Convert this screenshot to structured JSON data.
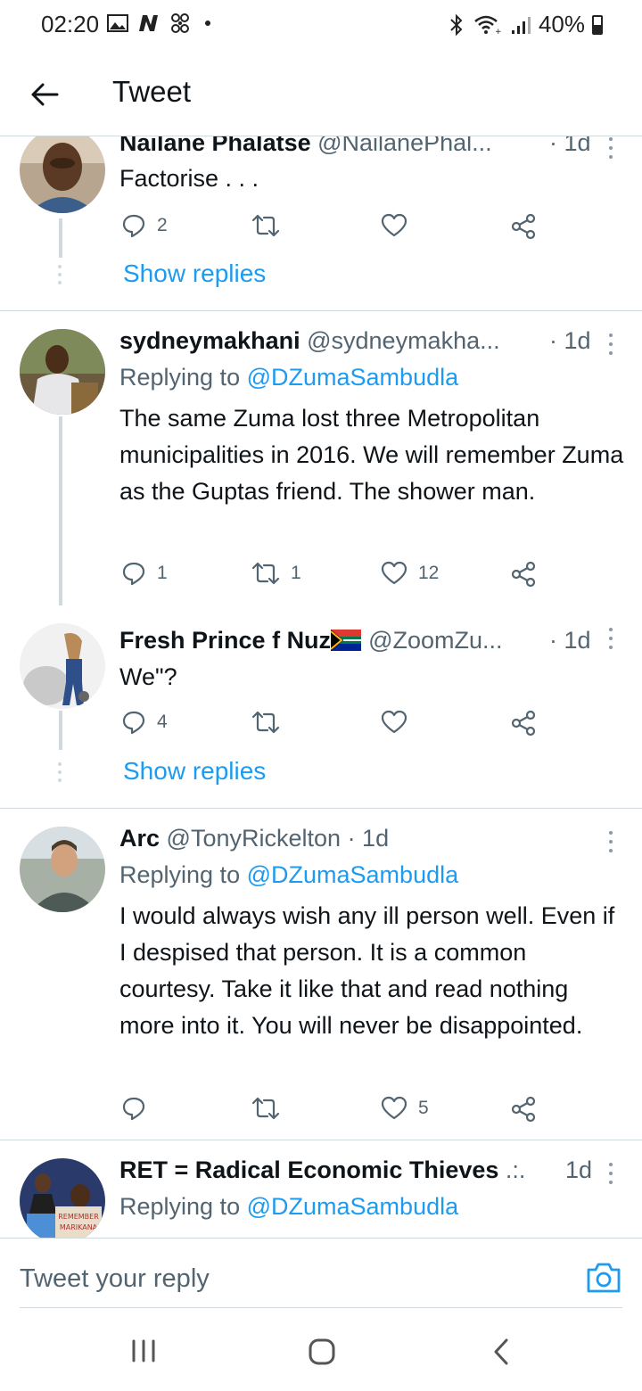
{
  "status_bar": {
    "time": "02:20",
    "battery": "40%",
    "icons": [
      "gallery-icon",
      "n-icon",
      "pinwheel-icon",
      "dot-icon",
      "bluetooth-icon",
      "wifi-icon",
      "signal-icon",
      "battery-icon"
    ]
  },
  "header": {
    "title": "Tweet",
    "back_icon": "arrow-left-icon"
  },
  "tweets": [
    {
      "name": "Nailane Phalatse",
      "handle": "@NailanePhal...",
      "time": "· 1d",
      "text": "Factorise . . .",
      "replies": "2",
      "retweets": "",
      "likes": "",
      "show_replies": "Show replies"
    },
    {
      "name": "sydneymakhani",
      "handle": "@sydneymakha...",
      "time": "· 1d",
      "replying_prefix": "Replying to",
      "replying_to": "@DZumaSambudla",
      "text": "The same Zuma lost three Metropolitan municipalities in 2016. We will remember Zuma as the Guptas friend. The shower man.",
      "replies": "1",
      "retweets": "1",
      "likes": "12"
    },
    {
      "name": "Fresh Prince f Nuz",
      "flag_icon": "south-africa-flag-icon",
      "handle": "@ZoomZu...",
      "time": "· 1d",
      "text": "We\"?",
      "replies": "4",
      "retweets": "",
      "likes": "",
      "show_replies": "Show replies"
    },
    {
      "name": "Arc",
      "handle": "@TonyRickelton",
      "time": "· 1d",
      "replying_prefix": "Replying to",
      "replying_to": "@DZumaSambudla",
      "text": "I would always wish any ill person well. Even if I despised that person. It is a common courtesy. Take it like that and read nothing more into it. You will never be disappointed.",
      "replies": "",
      "retweets": "",
      "likes": "5"
    },
    {
      "name": "RET = Radical Economic Thieves",
      "name_suffix": ".:.",
      "time": "1d",
      "replying_prefix": "Replying to",
      "replying_to": "@DZumaSambudla",
      "avatar_sign_text": "REMEMBER\nMARIKANA"
    }
  ],
  "reply_bar": {
    "placeholder": "Tweet your reply"
  },
  "colors": {
    "accent": "#1d9bf0",
    "text_primary": "#0f1419",
    "text_secondary": "#536471",
    "divider": "#cfd9de"
  }
}
